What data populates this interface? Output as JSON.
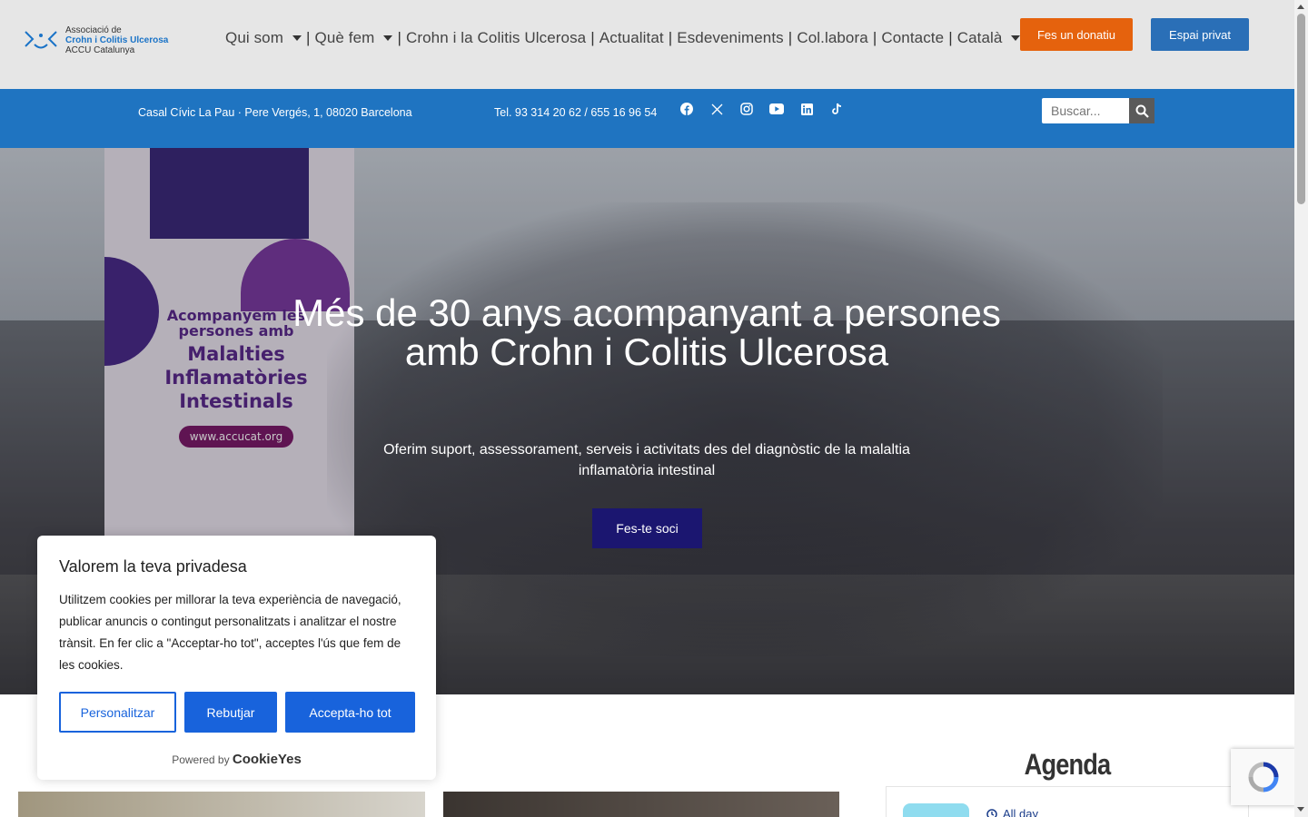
{
  "header": {
    "logo": {
      "line1": "Associació de",
      "line2": "Crohn i Colitis Ulcerosa",
      "line3": "ACCU Catalunya"
    },
    "nav": [
      {
        "label": "Qui som",
        "dropdown": true
      },
      {
        "label": "Què fem",
        "dropdown": true
      },
      {
        "label": "Crohn i la Colitis Ulcerosa",
        "dropdown": false
      },
      {
        "label": "Actualitat",
        "dropdown": false
      },
      {
        "label": "Esdeveniments",
        "dropdown": false
      },
      {
        "label": "Col.labora",
        "dropdown": false
      },
      {
        "label": "Contacte",
        "dropdown": false
      },
      {
        "label": "Català",
        "dropdown": true
      }
    ],
    "donate_label": "Fes un donatiu",
    "private_label": "Espai privat"
  },
  "infobar": {
    "address": "Casal Cívic La Pau · Pere Vergés, 1,  08020 Barcelona",
    "phone": "Tel. 93 314 20 62 / 655 16 96 54",
    "social": [
      "facebook-icon",
      "x-icon",
      "instagram-icon",
      "youtube-icon",
      "linkedin-icon",
      "tiktok-icon"
    ],
    "search_placeholder": "Buscar..."
  },
  "hero": {
    "title_line1": "Més de 30 anys acompanyant a persones",
    "title_line2": "amb Crohn i Colitis Ulcerosa",
    "subtitle": "Oferim suport, assessorament, serveis i activitats des del diagnòstic de la malaltia inflamatòria intestinal",
    "cta_label": "Fes-te soci",
    "banner_a": "Acompanyem les persones amb",
    "banner_b": "Malalties Inflamatòries Intestinals",
    "banner_url": "www.accucat.org"
  },
  "agenda": {
    "title": "Agenda",
    "allday": "All day"
  },
  "cookie": {
    "title": "Valorem la teva privadesa",
    "text": "Utilitzem cookies per millorar la teva experiència de navegació, publicar anuncis o contingut personalitzats i analitzar el nostre trànsit. En fer clic a \"Acceptar-ho tot\", acceptes l'ús que fem de les cookies.",
    "customize_label": "Personalitzar",
    "reject_label": "Rebutjar",
    "accept_label": "Accepta-ho tot",
    "powered_by": "Powered by",
    "powered_brand": "CookieYes"
  },
  "colors": {
    "header_bg": "#e6e6e6",
    "infobar_bg": "#1f74c1",
    "donate": "#e5620d",
    "private": "#2a6fb7",
    "cta": "#1b1670",
    "cookie_blue": "#1863dc"
  }
}
